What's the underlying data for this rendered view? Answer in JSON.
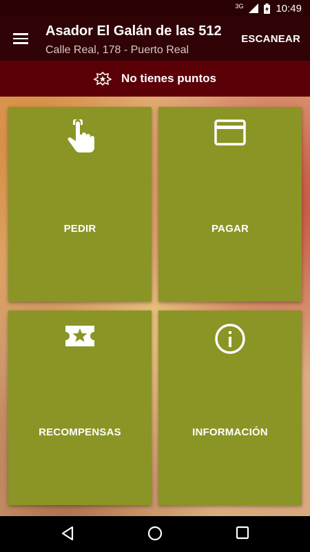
{
  "status_bar": {
    "network": "3G",
    "time": "10:49"
  },
  "app_bar": {
    "title": "Asador El Galán de las 512",
    "subtitle": "Calle Real, 178 - Puerto Real",
    "action_label": "ESCANEAR",
    "menu_icon": "hamburger-menu-icon"
  },
  "points": {
    "text": "No tienes puntos",
    "icon": "badge-star-icon"
  },
  "tiles": [
    {
      "label": "PEDIR",
      "icon": "touch-hand-icon"
    },
    {
      "label": "PAGAR",
      "icon": "credit-card-icon"
    },
    {
      "label": "RECOMPENSAS",
      "icon": "ticket-star-icon"
    },
    {
      "label": "INFORMACIÓN",
      "icon": "info-icon"
    }
  ],
  "nav": {
    "back_icon": "back-triangle-icon",
    "home_icon": "home-circle-icon",
    "recents_icon": "recents-square-icon"
  },
  "colors": {
    "app_bar": "#300306",
    "points_bar": "#5c0008",
    "tile": "#8a9526"
  }
}
